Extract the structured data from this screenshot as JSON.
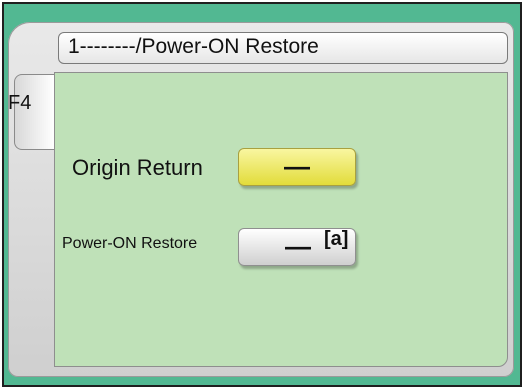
{
  "title": "1--------/Power-ON Restore",
  "side_tab": {
    "label": "F4"
  },
  "origin_return": {
    "label": "Origin Return",
    "value": "—"
  },
  "power_on_restore": {
    "label": "Power-ON Restore",
    "value": "—",
    "marker": "[a]"
  },
  "colors": {
    "outer_green": "#52b892",
    "content_green": "#bfe1b8",
    "yellow_button": "#e2dc3a",
    "gray_button": "#cfcfcf"
  }
}
